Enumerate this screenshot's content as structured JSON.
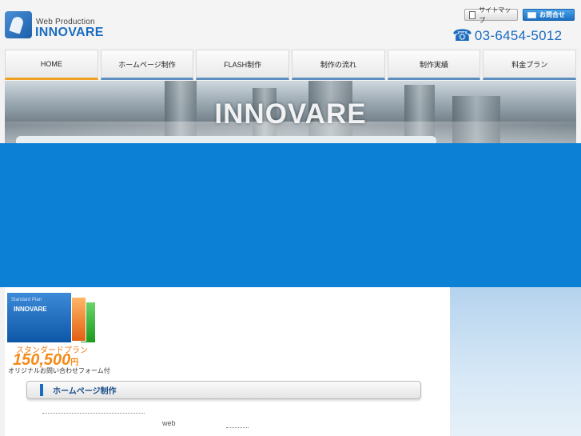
{
  "header": {
    "logo_sub": "Web Production",
    "logo_main": "INNOVARE",
    "sitemap_label": "サイトマップ",
    "contact_label": "お問合せ",
    "phone": "03-6454-5012",
    "phone_icon": "☎"
  },
  "nav": {
    "tabs": [
      {
        "label": "HOME"
      },
      {
        "label": "ホームページ制作"
      },
      {
        "label": "FLASH制作"
      },
      {
        "label": "制作の流れ"
      },
      {
        "label": "制作実績"
      },
      {
        "label": "料金プラン"
      }
    ]
  },
  "banner": {
    "title": "INNOVARE"
  },
  "plan": {
    "box_plan": "Standard Plan",
    "box_brand": "INNOVARE",
    "name": "スタンダードプラン",
    "price": "150,500",
    "price_unit": "円",
    "note": "オリジナルお問い合わせフォーム付"
  },
  "section": {
    "title": "ホームページ制作",
    "body_word": "web"
  },
  "colors": {
    "brand_blue": "#1b6cc0",
    "blue_block": "#0b80d4",
    "accent_orange": "#f58a16"
  }
}
